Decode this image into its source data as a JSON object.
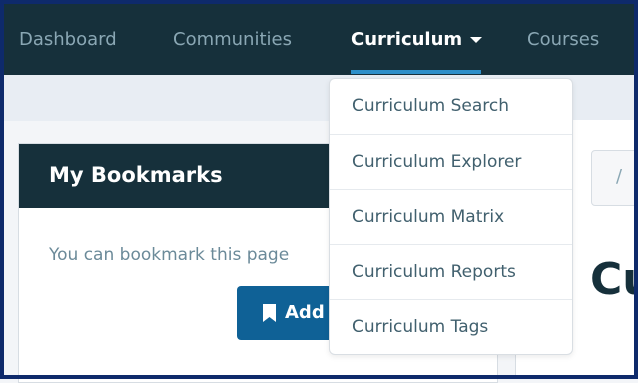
{
  "topnav": {
    "items": [
      {
        "label": "Dashboard"
      },
      {
        "label": "Communities"
      },
      {
        "label": "Curriculum"
      },
      {
        "label": "Courses"
      }
    ],
    "active_item": "Curriculum"
  },
  "dropdown": {
    "items": [
      {
        "label": "Curriculum Search"
      },
      {
        "label": "Curriculum Explorer"
      },
      {
        "label": "Curriculum Matrix"
      },
      {
        "label": "Curriculum Reports"
      },
      {
        "label": "Curriculum Tags"
      }
    ]
  },
  "bookmarks": {
    "title": "My Bookmarks",
    "text": "You can bookmark this page",
    "button_label": "Add I"
  },
  "main": {
    "breadcrumb_separator": "/",
    "heading_partial": "Cu"
  },
  "colors": {
    "nav_bg": "#16303b",
    "accent": "#2d8fc9",
    "button": "#0f6196",
    "frame": "#0e2a6b"
  },
  "icons": {
    "dropdown_caret": "caret-down-icon",
    "bookmark": "bookmark-icon"
  }
}
